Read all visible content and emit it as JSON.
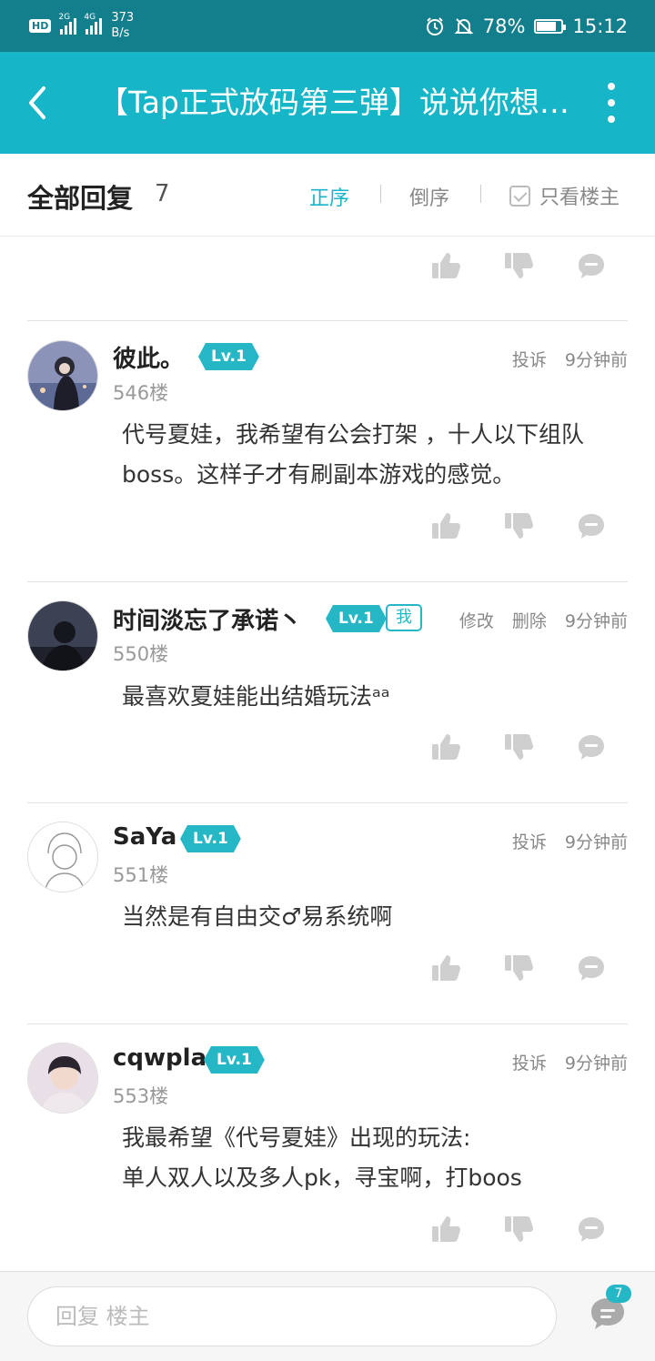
{
  "status_bar": {
    "hd": "HD",
    "net1": "2G",
    "net2": "4G",
    "speed_value": "373",
    "speed_unit": "B/s",
    "battery": "78%",
    "time": "15:12"
  },
  "header": {
    "title": "【Tap正式放码第三弹】说说你想要在《代号夏娃》里看到的玩法"
  },
  "filter": {
    "all_label": "全部回复",
    "count": "7",
    "asc_label": "正序",
    "desc_label": "倒序",
    "only_host_label": "只看楼主"
  },
  "colors": {
    "accent": "#17b5c8",
    "status_bar": "#137e8c",
    "level_badge": "#26b7c6"
  },
  "comments": [
    {
      "username": "彼此。",
      "level": "Lv.1",
      "actions": [
        "投诉"
      ],
      "time": "9分钟前",
      "floor": "546楼",
      "content": "代号夏娃，我希望有公会打架 ，十人以下组队boss。这样子才有刷副本游戏的感觉。"
    },
    {
      "username": "时间淡忘了承诺丶",
      "level": "Lv.1",
      "me_tag": "我",
      "actions": [
        "修改",
        "删除"
      ],
      "time": "9分钟前",
      "floor": "550楼",
      "content": "最喜欢夏娃能出结婚玩法ᵃᵃ"
    },
    {
      "username": "SaYa",
      "level": "Lv.1",
      "actions": [
        "投诉"
      ],
      "time": "9分钟前",
      "floor": "551楼",
      "content": "当然是有自由交♂易系统啊"
    },
    {
      "username": "cqwpla",
      "level": "Lv.1",
      "actions": [
        "投诉"
      ],
      "time": "9分钟前",
      "floor": "553楼",
      "content_line1": "我最希望《代号夏娃》出现的玩法:",
      "content_line2": "单人双人以及多人pk，寻宝啊，打boos"
    }
  ],
  "bottom": {
    "reply_placeholder": "回复  楼主",
    "badge_count": "7"
  }
}
